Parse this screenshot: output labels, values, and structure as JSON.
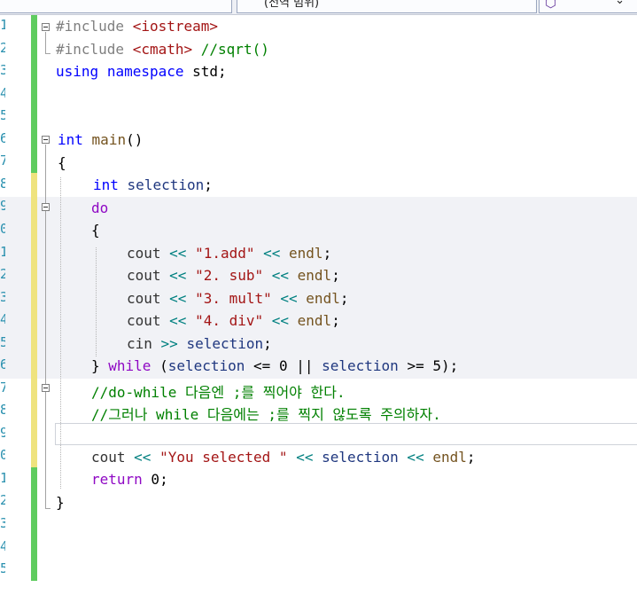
{
  "toolbar": {
    "scope_dropdown_partial": "(전역 범위)"
  },
  "colors": {
    "keyword": "#0000ff",
    "control_keyword": "#8f08c4",
    "string": "#a31515",
    "comment": "#008000",
    "variable": "#1f377f",
    "line_number": "#2b91af",
    "saved_change": "#5fcc5f",
    "unsaved_change": "#efe37e"
  },
  "editor": {
    "line_numbers": [
      "1",
      "2",
      "3",
      "4",
      "5",
      "6",
      "7",
      "8",
      "9",
      "0",
      "1",
      "2",
      "3",
      "4",
      "5",
      "6",
      "7",
      "8",
      "9",
      "0",
      "1",
      "2",
      "3",
      "4",
      "5"
    ],
    "lines": {
      "l1": {
        "pp": "#include ",
        "inc": "<iostream>"
      },
      "l2": {
        "pp": "#include ",
        "inc": "<cmath>",
        "cm": " //sqrt()"
      },
      "l3": {
        "kw1": "using",
        "sp": " ",
        "kw2": "namespace",
        "rest": " std;"
      },
      "l6": {
        "kw": "int",
        "sp": " ",
        "fn": "main",
        "rest": "()"
      },
      "l7": {
        "text": "{"
      },
      "l8": {
        "kw": "int",
        "sp": " ",
        "var": "selection",
        "rest": ";"
      },
      "l9": {
        "kw": "do"
      },
      "l10": {
        "text": "{"
      },
      "l11": {
        "obj": "cout",
        "op1": " << ",
        "str": "\"1.add\"",
        "op2": " << ",
        "fn": "endl",
        "rest": ";"
      },
      "l12": {
        "obj": "cout",
        "op1": " << ",
        "str": "\"2. sub\"",
        "op2": " << ",
        "fn": "endl",
        "rest": ";"
      },
      "l13": {
        "obj": "cout",
        "op1": " << ",
        "str": "\"3. mult\"",
        "op2": " << ",
        "fn": "endl",
        "rest": ";"
      },
      "l14": {
        "obj": "cout",
        "op1": " << ",
        "str": "\"4. div\"",
        "op2": " << ",
        "fn": "endl",
        "rest": ";"
      },
      "l15": {
        "obj": "cin",
        "op1": " >> ",
        "var": "selection",
        "rest": ";"
      },
      "l16": {
        "a": "} ",
        "kw": "while",
        "b": " (",
        "var1": "selection",
        "c": " <= 0 || ",
        "var2": "selection",
        "d": " >= 5);"
      },
      "l17": {
        "cm": "//do-while 다음엔 ;를 찍어야 한다."
      },
      "l18": {
        "cm": "//그러나 while 다음에는 ;를 찍지 않도록 주의하자."
      },
      "l20": {
        "obj": "cout",
        "op1": " << ",
        "str": "\"You selected \"",
        "op2": " << ",
        "var": "selection",
        "op3": " << ",
        "fn": "endl",
        "rest": ";"
      },
      "l21": {
        "kw": "return",
        "rest": " 0;"
      },
      "l22": {
        "text": "}"
      }
    }
  }
}
